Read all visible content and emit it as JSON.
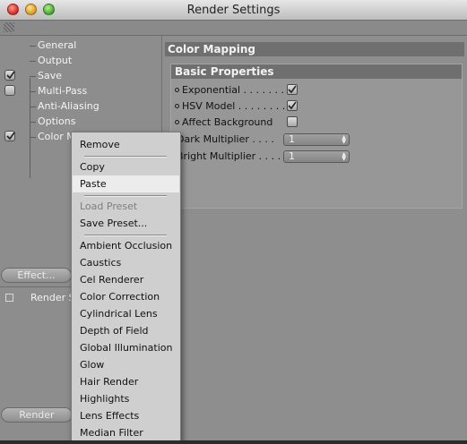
{
  "window": {
    "title": "Render Settings"
  },
  "tree": {
    "items": [
      {
        "label": "General",
        "checkbox": "none"
      },
      {
        "label": "Output",
        "checkbox": "none"
      },
      {
        "label": "Save",
        "checkbox": "checked"
      },
      {
        "label": "Multi-Pass",
        "checkbox": "unchecked"
      },
      {
        "label": "Anti-Aliasing",
        "checkbox": "none"
      },
      {
        "label": "Options",
        "checkbox": "none"
      },
      {
        "label": "Color M",
        "checkbox": "checked"
      }
    ]
  },
  "left": {
    "effect_button": "Effect...",
    "render_setting_label": "Render S",
    "bottom_button": "Render"
  },
  "panel": {
    "title": "Color Mapping",
    "group_title": "Basic Properties",
    "props": {
      "exponential": {
        "label": "Exponential . . . . . . .",
        "checked": true
      },
      "hsv": {
        "label": "HSV Model . . . . . . . .",
        "checked": true
      },
      "affect_bg": {
        "label": "Affect Background",
        "checked": false
      },
      "dark": {
        "label": "Dark Multiplier . . . .",
        "value": "1"
      },
      "bright": {
        "label": "Bright Multiplier . . . .",
        "value": "1"
      }
    }
  },
  "context_menu": {
    "items": [
      {
        "label": "Remove",
        "state": "normal"
      },
      {
        "label": "Copy",
        "state": "normal"
      },
      {
        "label": "Paste",
        "state": "highlighted"
      },
      {
        "label": "Load Preset",
        "state": "disabled"
      },
      {
        "label": "Save Preset...",
        "state": "normal"
      },
      {
        "label": "Ambient Occlusion",
        "state": "normal"
      },
      {
        "label": "Caustics",
        "state": "normal"
      },
      {
        "label": "Cel Renderer",
        "state": "normal"
      },
      {
        "label": "Color Correction",
        "state": "normal"
      },
      {
        "label": "Cylindrical Lens",
        "state": "normal"
      },
      {
        "label": "Depth of Field",
        "state": "normal"
      },
      {
        "label": "Global Illumination",
        "state": "normal"
      },
      {
        "label": "Glow",
        "state": "normal"
      },
      {
        "label": "Hair Render",
        "state": "normal"
      },
      {
        "label": "Highlights",
        "state": "normal"
      },
      {
        "label": "Lens Effects",
        "state": "normal"
      },
      {
        "label": "Median Filter",
        "state": "normal"
      }
    ]
  },
  "colors": {
    "menu_bg": "#cfcfcf",
    "highlight": "#ececec",
    "panel_header": "#6f6f6f"
  }
}
